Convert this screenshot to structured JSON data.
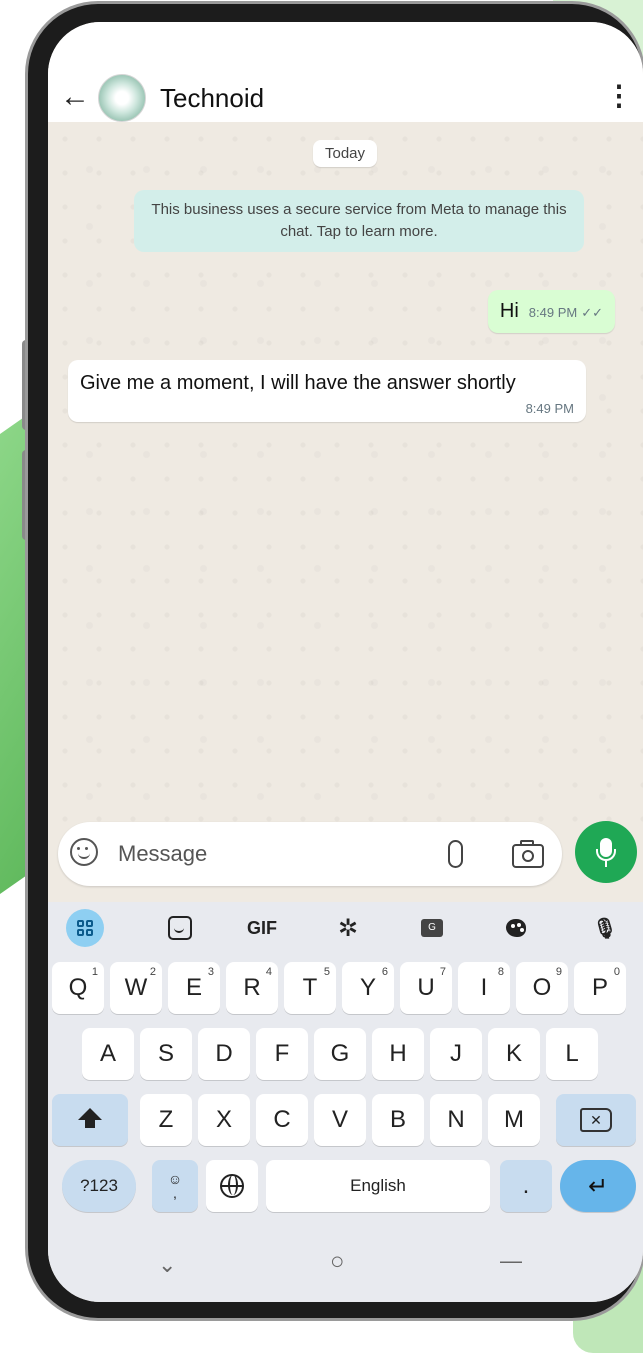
{
  "colors": {
    "chat_background": "#efeae2",
    "outgoing_bubble": "#d9fdd3",
    "incoming_bubble": "#ffffff",
    "system_notice": "#d3eeea",
    "accent_green": "#1fa855",
    "keyboard_accent": "#66b5ea"
  },
  "header": {
    "title": "Technoid",
    "back_icon": "arrow-left-icon",
    "menu_icon": "more-vertical-icon",
    "back_glyph": "←",
    "menu_glyph": "⋮"
  },
  "chat": {
    "date_chip": "Today",
    "system_notice": "This business uses a secure service from Meta to manage this chat. Tap to learn more.",
    "messages": [
      {
        "direction": "outgoing",
        "text": "Hi",
        "time": "8:49 PM",
        "status": "read",
        "status_glyph": "✓✓"
      },
      {
        "direction": "incoming",
        "text": "Give me a moment, I will have the answer shortly",
        "time": "8:49 PM"
      }
    ]
  },
  "composer": {
    "placeholder": "Message",
    "emoji_icon": "smiley-icon",
    "attach_icon": "paperclip-icon",
    "camera_icon": "camera-icon",
    "send_icon": "microphone-icon"
  },
  "keyboard": {
    "toolbar": {
      "gif_label": "GIF",
      "gear_glyph": "✲",
      "translate_glyph": "G",
      "mic_glyph": "🎙",
      "icons": [
        "apps-grid-icon",
        "sticker-icon",
        "gif-icon",
        "gear-icon",
        "translate-icon",
        "palette-icon",
        "microphone-icon"
      ]
    },
    "row1": [
      {
        "key": "Q",
        "sup": "1"
      },
      {
        "key": "W",
        "sup": "2"
      },
      {
        "key": "E",
        "sup": "3"
      },
      {
        "key": "R",
        "sup": "4"
      },
      {
        "key": "T",
        "sup": "5"
      },
      {
        "key": "Y",
        "sup": "6"
      },
      {
        "key": "U",
        "sup": "7"
      },
      {
        "key": "I",
        "sup": "8"
      },
      {
        "key": "O",
        "sup": "9"
      },
      {
        "key": "P",
        "sup": "0"
      }
    ],
    "row2": [
      "A",
      "S",
      "D",
      "F",
      "G",
      "H",
      "J",
      "K",
      "L"
    ],
    "row3": [
      "Z",
      "X",
      "C",
      "V",
      "B",
      "N",
      "M"
    ],
    "backspace_glyph": "✕",
    "row4": {
      "symbols": "?123",
      "emoji_top": "☺",
      "emoji_bottom": ",",
      "space": "English",
      "period": ".",
      "enter_glyph": "↵"
    }
  },
  "nav": {
    "back_glyph": "⌄",
    "home_glyph": "○",
    "recents_glyph": "—"
  }
}
